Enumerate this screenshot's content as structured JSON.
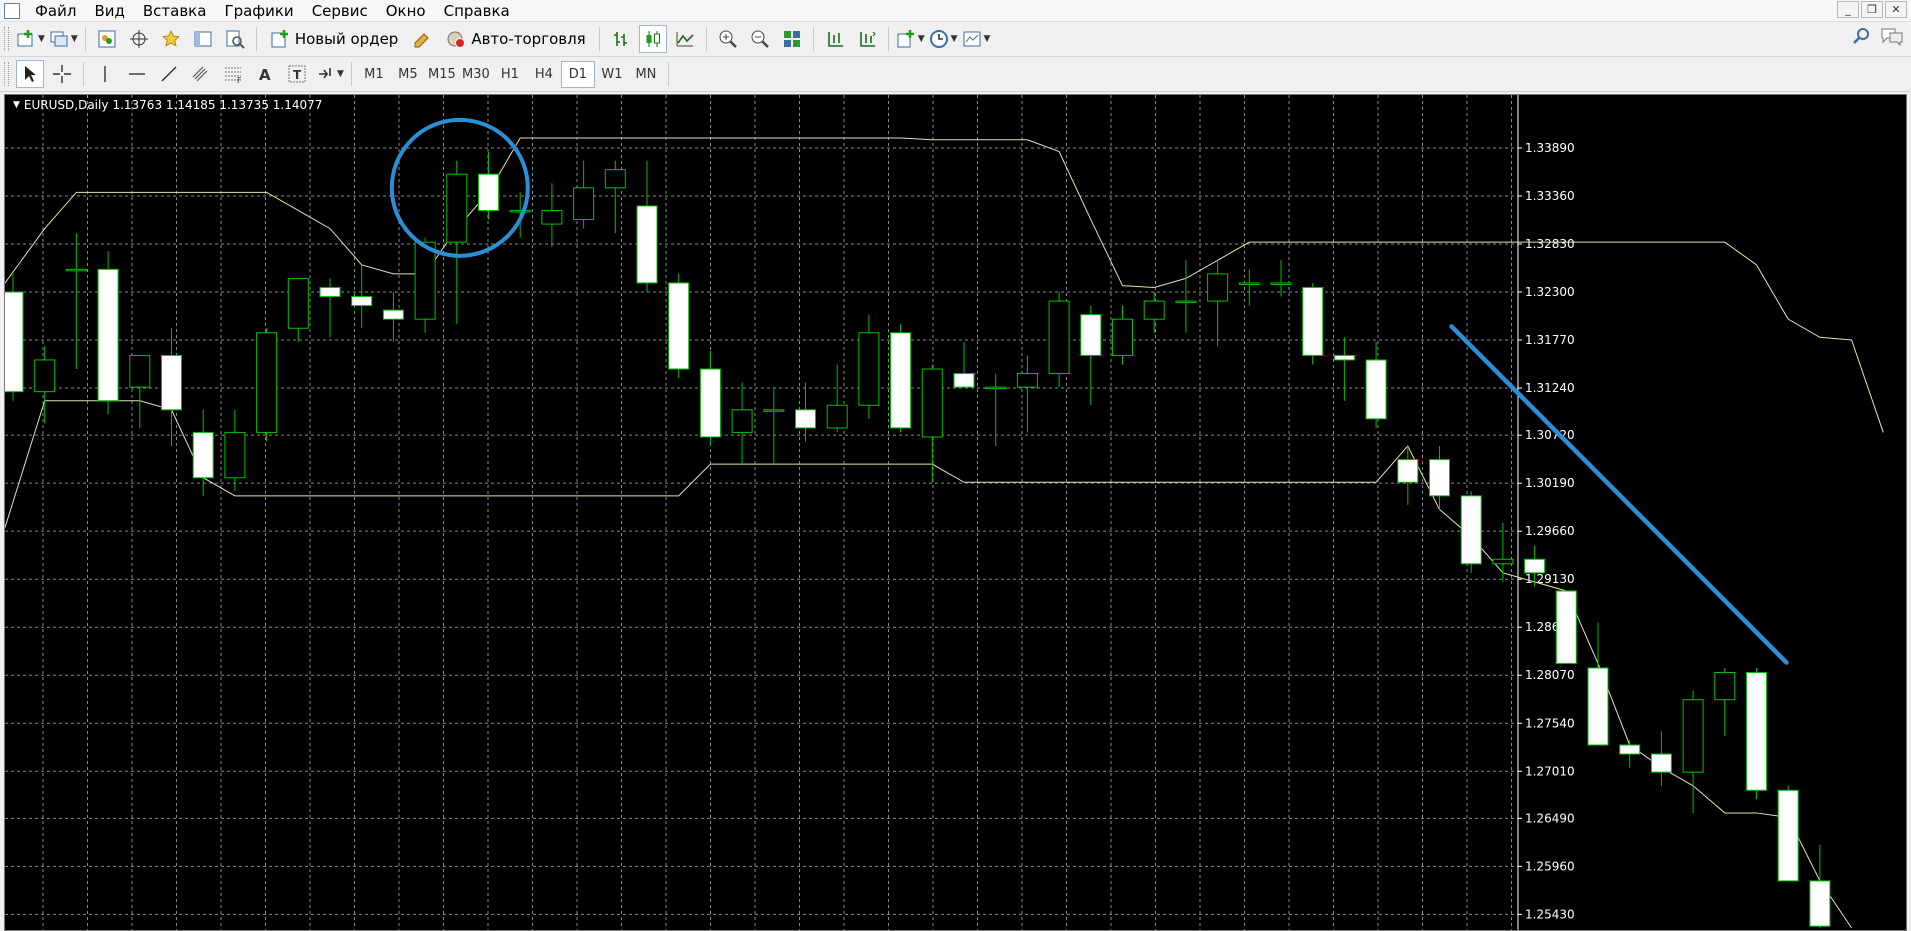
{
  "menu": [
    "Файл",
    "Вид",
    "Вставка",
    "Графики",
    "Сервис",
    "Окно",
    "Справка"
  ],
  "window_controls": [
    "_",
    "❐",
    "✕"
  ],
  "toolbar": {
    "new_order": "Новый ордер",
    "auto_trading": "Авто-торговля"
  },
  "timeframes": [
    "M1",
    "M5",
    "M15",
    "M30",
    "H1",
    "H4",
    "D1",
    "W1",
    "MN"
  ],
  "active_timeframe": "D1",
  "chart": {
    "symbol_tf": "EURUSD,Daily",
    "ohlc": "1.13763 1.14185 1.13735 1.14077",
    "background": "#000000",
    "grid_color": "#8a8a8a",
    "bull_color": "#000000",
    "bear_color": "#ffffff",
    "candle_outline": "#00c000",
    "channel_color": "#e8e0b0",
    "annotation_color": "#2a8fd4"
  },
  "chart_data": {
    "type": "candlestick",
    "title": "EURUSD,Daily",
    "price_labels": [
      "1.33890",
      "1.33360",
      "1.32830",
      "1.32300",
      "1.31770",
      "1.31240",
      "1.30720",
      "1.30190",
      "1.29660",
      "1.29130",
      "1.28600",
      "1.28070",
      "1.27540",
      "1.27010",
      "1.26490",
      "1.25960",
      "1.25430"
    ],
    "ylim": [
      1.2528,
      1.3432
    ],
    "grid": true,
    "candles": [
      {
        "o": 1.323,
        "h": 1.325,
        "l": 1.311,
        "c": 1.312
      },
      {
        "o": 1.312,
        "h": 1.317,
        "l": 1.3085,
        "c": 1.3155
      },
      {
        "o": 1.3255,
        "h": 1.3295,
        "l": 1.3145,
        "c": 1.3255
      },
      {
        "o": 1.3255,
        "h": 1.3275,
        "l": 1.3095,
        "c": 1.311
      },
      {
        "o": 1.3125,
        "h": 1.316,
        "l": 1.308,
        "c": 1.316
      },
      {
        "o": 1.316,
        "h": 1.319,
        "l": 1.306,
        "c": 1.31
      },
      {
        "o": 1.3075,
        "h": 1.31,
        "l": 1.3005,
        "c": 1.3025
      },
      {
        "o": 1.3025,
        "h": 1.31,
        "l": 1.301,
        "c": 1.3075
      },
      {
        "o": 1.3075,
        "h": 1.319,
        "l": 1.3065,
        "c": 1.3185
      },
      {
        "o": 1.319,
        "h": 1.3245,
        "l": 1.3175,
        "c": 1.3245
      },
      {
        "o": 1.3235,
        "h": 1.3245,
        "l": 1.318,
        "c": 1.3225
      },
      {
        "o": 1.3225,
        "h": 1.326,
        "l": 1.319,
        "c": 1.3215
      },
      {
        "o": 1.321,
        "h": 1.323,
        "l": 1.3175,
        "c": 1.32
      },
      {
        "o": 1.32,
        "h": 1.329,
        "l": 1.3185,
        "c": 1.3285
      },
      {
        "o": 1.3285,
        "h": 1.3375,
        "l": 1.3195,
        "c": 1.336
      },
      {
        "o": 1.336,
        "h": 1.3385,
        "l": 1.331,
        "c": 1.332
      },
      {
        "o": 1.332,
        "h": 1.334,
        "l": 1.329,
        "c": 1.332
      },
      {
        "o": 1.3305,
        "h": 1.335,
        "l": 1.328,
        "c": 1.332
      },
      {
        "o": 1.331,
        "h": 1.3375,
        "l": 1.33,
        "c": 1.3345
      },
      {
        "o": 1.3345,
        "h": 1.3375,
        "l": 1.3295,
        "c": 1.3365
      },
      {
        "o": 1.3325,
        "h": 1.3375,
        "l": 1.323,
        "c": 1.324
      },
      {
        "o": 1.324,
        "h": 1.325,
        "l": 1.3135,
        "c": 1.3145
      },
      {
        "o": 1.3145,
        "h": 1.3165,
        "l": 1.306,
        "c": 1.307
      },
      {
        "o": 1.3075,
        "h": 1.313,
        "l": 1.304,
        "c": 1.31
      },
      {
        "o": 1.31,
        "h": 1.3125,
        "l": 1.304,
        "c": 1.31
      },
      {
        "o": 1.31,
        "h": 1.313,
        "l": 1.3065,
        "c": 1.308
      },
      {
        "o": 1.308,
        "h": 1.315,
        "l": 1.3075,
        "c": 1.3105
      },
      {
        "o": 1.3105,
        "h": 1.3205,
        "l": 1.309,
        "c": 1.3185
      },
      {
        "o": 1.3185,
        "h": 1.3195,
        "l": 1.3075,
        "c": 1.308
      },
      {
        "o": 1.307,
        "h": 1.315,
        "l": 1.302,
        "c": 1.3145
      },
      {
        "o": 1.314,
        "h": 1.3175,
        "l": 1.3125,
        "c": 1.3125
      },
      {
        "o": 1.3125,
        "h": 1.314,
        "l": 1.306,
        "c": 1.3125
      },
      {
        "o": 1.3125,
        "h": 1.316,
        "l": 1.3075,
        "c": 1.314
      },
      {
        "o": 1.314,
        "h": 1.323,
        "l": 1.3125,
        "c": 1.322
      },
      {
        "o": 1.3205,
        "h": 1.3215,
        "l": 1.3105,
        "c": 1.316
      },
      {
        "o": 1.316,
        "h": 1.3215,
        "l": 1.315,
        "c": 1.32
      },
      {
        "o": 1.32,
        "h": 1.323,
        "l": 1.3185,
        "c": 1.322
      },
      {
        "o": 1.322,
        "h": 1.3265,
        "l": 1.3185,
        "c": 1.322
      },
      {
        "o": 1.322,
        "h": 1.3265,
        "l": 1.317,
        "c": 1.325
      },
      {
        "o": 1.324,
        "h": 1.3255,
        "l": 1.3215,
        "c": 1.324
      },
      {
        "o": 1.324,
        "h": 1.3265,
        "l": 1.3225,
        "c": 1.324
      },
      {
        "o": 1.3235,
        "h": 1.324,
        "l": 1.315,
        "c": 1.316
      },
      {
        "o": 1.316,
        "h": 1.318,
        "l": 1.311,
        "c": 1.3155
      },
      {
        "o": 1.3155,
        "h": 1.3175,
        "l": 1.308,
        "c": 1.309
      },
      {
        "o": 1.3045,
        "h": 1.306,
        "l": 1.2995,
        "c": 1.302
      },
      {
        "o": 1.3045,
        "h": 1.306,
        "l": 1.299,
        "c": 1.3005
      },
      {
        "o": 1.3005,
        "h": 1.301,
        "l": 1.292,
        "c": 1.293
      },
      {
        "o": 1.293,
        "h": 1.2975,
        "l": 1.291,
        "c": 1.2935
      },
      {
        "o": 1.2935,
        "h": 1.295,
        "l": 1.2905,
        "c": 1.292
      },
      {
        "o": 1.29,
        "h": 1.29,
        "l": 1.282,
        "c": 1.282
      },
      {
        "o": 1.2815,
        "h": 1.2865,
        "l": 1.2735,
        "c": 1.273
      },
      {
        "o": 1.273,
        "h": 1.2735,
        "l": 1.2705,
        "c": 1.272
      },
      {
        "o": 1.272,
        "h": 1.2745,
        "l": 1.2685,
        "c": 1.27
      },
      {
        "o": 1.27,
        "h": 1.279,
        "l": 1.2655,
        "c": 1.278
      },
      {
        "o": 1.278,
        "h": 1.2815,
        "l": 1.274,
        "c": 1.281
      },
      {
        "o": 1.281,
        "h": 1.2815,
        "l": 1.267,
        "c": 1.268
      },
      {
        "o": 1.268,
        "h": 1.2685,
        "l": 1.258,
        "c": 1.258
      },
      {
        "o": 1.258,
        "h": 1.262,
        "l": 1.2528,
        "c": 1.253
      }
    ],
    "channel_upper": [
      1.324,
      1.33,
      1.334,
      1.334,
      1.334,
      1.334,
      1.334,
      1.334,
      1.334,
      1.332,
      1.33,
      1.326,
      1.325,
      1.325,
      1.33,
      1.334,
      1.34,
      1.34,
      1.34,
      1.34,
      1.34,
      1.34,
      1.34,
      1.34,
      1.34,
      1.34,
      1.34,
      1.34,
      1.34,
      1.3398,
      1.3398,
      1.3398,
      1.3398,
      1.3385,
      1.331,
      1.3237,
      1.3235,
      1.3245,
      1.3265,
      1.3285,
      1.3285,
      1.3285,
      1.3285,
      1.3285,
      1.3285,
      1.3285,
      1.3285,
      1.3285,
      1.3285,
      1.3285,
      1.3285,
      1.3285,
      1.3285,
      1.3285,
      1.3285,
      1.326,
      1.32,
      1.318,
      1.3177,
      1.3075
    ],
    "channel_lower": [
      1.297,
      1.311,
      1.311,
      1.311,
      1.311,
      1.31,
      1.3025,
      1.3005,
      1.3005,
      1.3005,
      1.3005,
      1.3005,
      1.3005,
      1.3005,
      1.3005,
      1.3005,
      1.3005,
      1.3005,
      1.3005,
      1.3005,
      1.3005,
      1.3005,
      1.304,
      1.304,
      1.304,
      1.304,
      1.304,
      1.304,
      1.304,
      1.304,
      1.302,
      1.302,
      1.302,
      1.302,
      1.302,
      1.302,
      1.302,
      1.302,
      1.302,
      1.302,
      1.302,
      1.302,
      1.302,
      1.302,
      1.306,
      1.299,
      1.296,
      1.292,
      1.291,
      1.29,
      1.282,
      1.273,
      1.2705,
      1.2685,
      1.2655,
      1.2655,
      1.265,
      1.258,
      1.2528
    ]
  }
}
